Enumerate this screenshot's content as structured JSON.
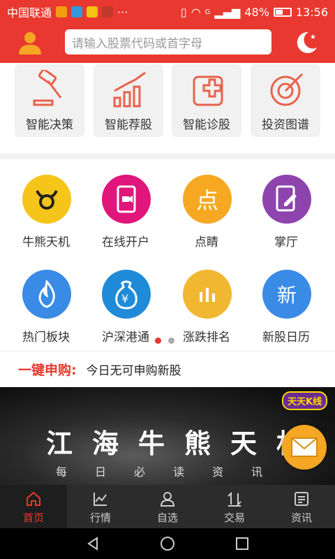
{
  "status_bar": {
    "carrier": "中国联通",
    "more": "···",
    "network_type": "G",
    "battery": "48%",
    "time": "13:56"
  },
  "header": {
    "search_placeholder": "请输入股票代码或首字母"
  },
  "tools": [
    {
      "label": "智能决策",
      "icon": "gavel-icon"
    },
    {
      "label": "智能荐股",
      "icon": "growth-chart-icon"
    },
    {
      "label": "智能诊股",
      "icon": "medical-kit-icon"
    },
    {
      "label": "投资图谱",
      "icon": "target-icon"
    }
  ],
  "features": [
    {
      "label": "牛熊天机",
      "icon": "bull-icon",
      "color": "#f6c519",
      "glyph": "♉"
    },
    {
      "label": "在线开户",
      "icon": "phone-camera-icon",
      "color": "#e0167b",
      "glyph": "▶"
    },
    {
      "label": "点睛",
      "icon": "point-icon",
      "color": "#f6a823",
      "glyph": "点"
    },
    {
      "label": "掌厅",
      "icon": "tablet-edit-icon",
      "color": "#8e44ad",
      "glyph": "✎"
    },
    {
      "label": "热门板块",
      "icon": "flame-icon",
      "color": "#3a8be6",
      "glyph": "🔥"
    },
    {
      "label": "沪深港通",
      "icon": "money-bag-icon",
      "color": "#1f8bd8",
      "glyph": "¥"
    },
    {
      "label": "涨跌排名",
      "icon": "bar-chart-icon",
      "color": "#f2b731",
      "glyph": "▮"
    },
    {
      "label": "新股日历",
      "icon": "new-stock-icon",
      "color": "#3a8be6",
      "glyph": "新"
    }
  ],
  "ipo": {
    "label": "一键申购:",
    "text": "今日无可申购新股"
  },
  "banner": {
    "title": "江海牛熊天机",
    "subtitle": "每日必读资讯",
    "tag": "天天K线"
  },
  "tabs": [
    {
      "label": "首页",
      "icon": "home-icon"
    },
    {
      "label": "行情",
      "icon": "market-chart-icon"
    },
    {
      "label": "自选",
      "icon": "user-icon"
    },
    {
      "label": "交易",
      "icon": "trade-arrows-icon"
    },
    {
      "label": "资讯",
      "icon": "news-icon"
    }
  ],
  "colors": {
    "primary": "#e8382f",
    "tabbar": "#2c2c2c"
  }
}
